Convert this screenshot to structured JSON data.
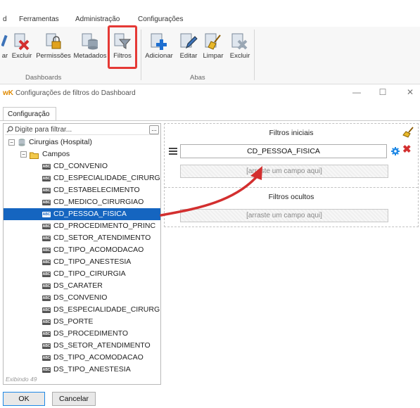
{
  "menu": [
    "d",
    "Ferramentas",
    "Administração",
    "Configurações"
  ],
  "ribbon": {
    "groups": [
      {
        "name": "Dashboards",
        "buttons": [
          "ar",
          "Excluir",
          "Permissões",
          "Metadados",
          "Filtros"
        ]
      },
      {
        "name": "Abas",
        "buttons": [
          "Adicionar",
          "Editar",
          "Limpar",
          "Excluir"
        ]
      }
    ]
  },
  "window": {
    "logo": "wK",
    "title": "Configurações de filtros do Dashboard",
    "min": "—",
    "max": "☐",
    "close": "✕"
  },
  "tab": {
    "label": "Configuração"
  },
  "leftpanel": {
    "filter_placeholder": "Digite para filtrar...",
    "filter_button": "...",
    "root": "Cirurgias (Hospital)",
    "folder": "Campos",
    "fields": [
      "CD_CONVENIO",
      "CD_ESPECIALIDADE_CIRURGIAO",
      "CD_ESTABELECIMENTO",
      "CD_MEDICO_CIRURGIAO",
      "CD_PESSOA_FISICA",
      "CD_PROCEDIMENTO_PRINC",
      "CD_SETOR_ATENDIMENTO",
      "CD_TIPO_ACOMODACAO",
      "CD_TIPO_ANESTESIA",
      "CD_TIPO_CIRURGIA",
      "DS_CARATER",
      "DS_CONVENIO",
      "DS_ESPECIALIDADE_CIRURGIAO",
      "DS_PORTE",
      "DS_PROCEDIMENTO",
      "DS_SETOR_ATENDIMENTO",
      "DS_TIPO_ACOMODACAO",
      "DS_TIPO_ANESTESIA"
    ],
    "selected_field": "CD_PESSOA_FISICA",
    "type_badge": "ABC",
    "showing": "Exibindo 49"
  },
  "rightpanel": {
    "initial_title": "Filtros iniciais",
    "initial_field": "CD_PESSOA_FISICA",
    "drop_placeholder": "[arraste um campo aqui]",
    "hidden_title": "Filtros ocultos"
  },
  "buttons": {
    "ok": "OK",
    "cancel": "Cancelar"
  },
  "colors": {
    "selection": "#1565c0",
    "highlight": "#e53935",
    "arrow": "#d32f2f"
  }
}
